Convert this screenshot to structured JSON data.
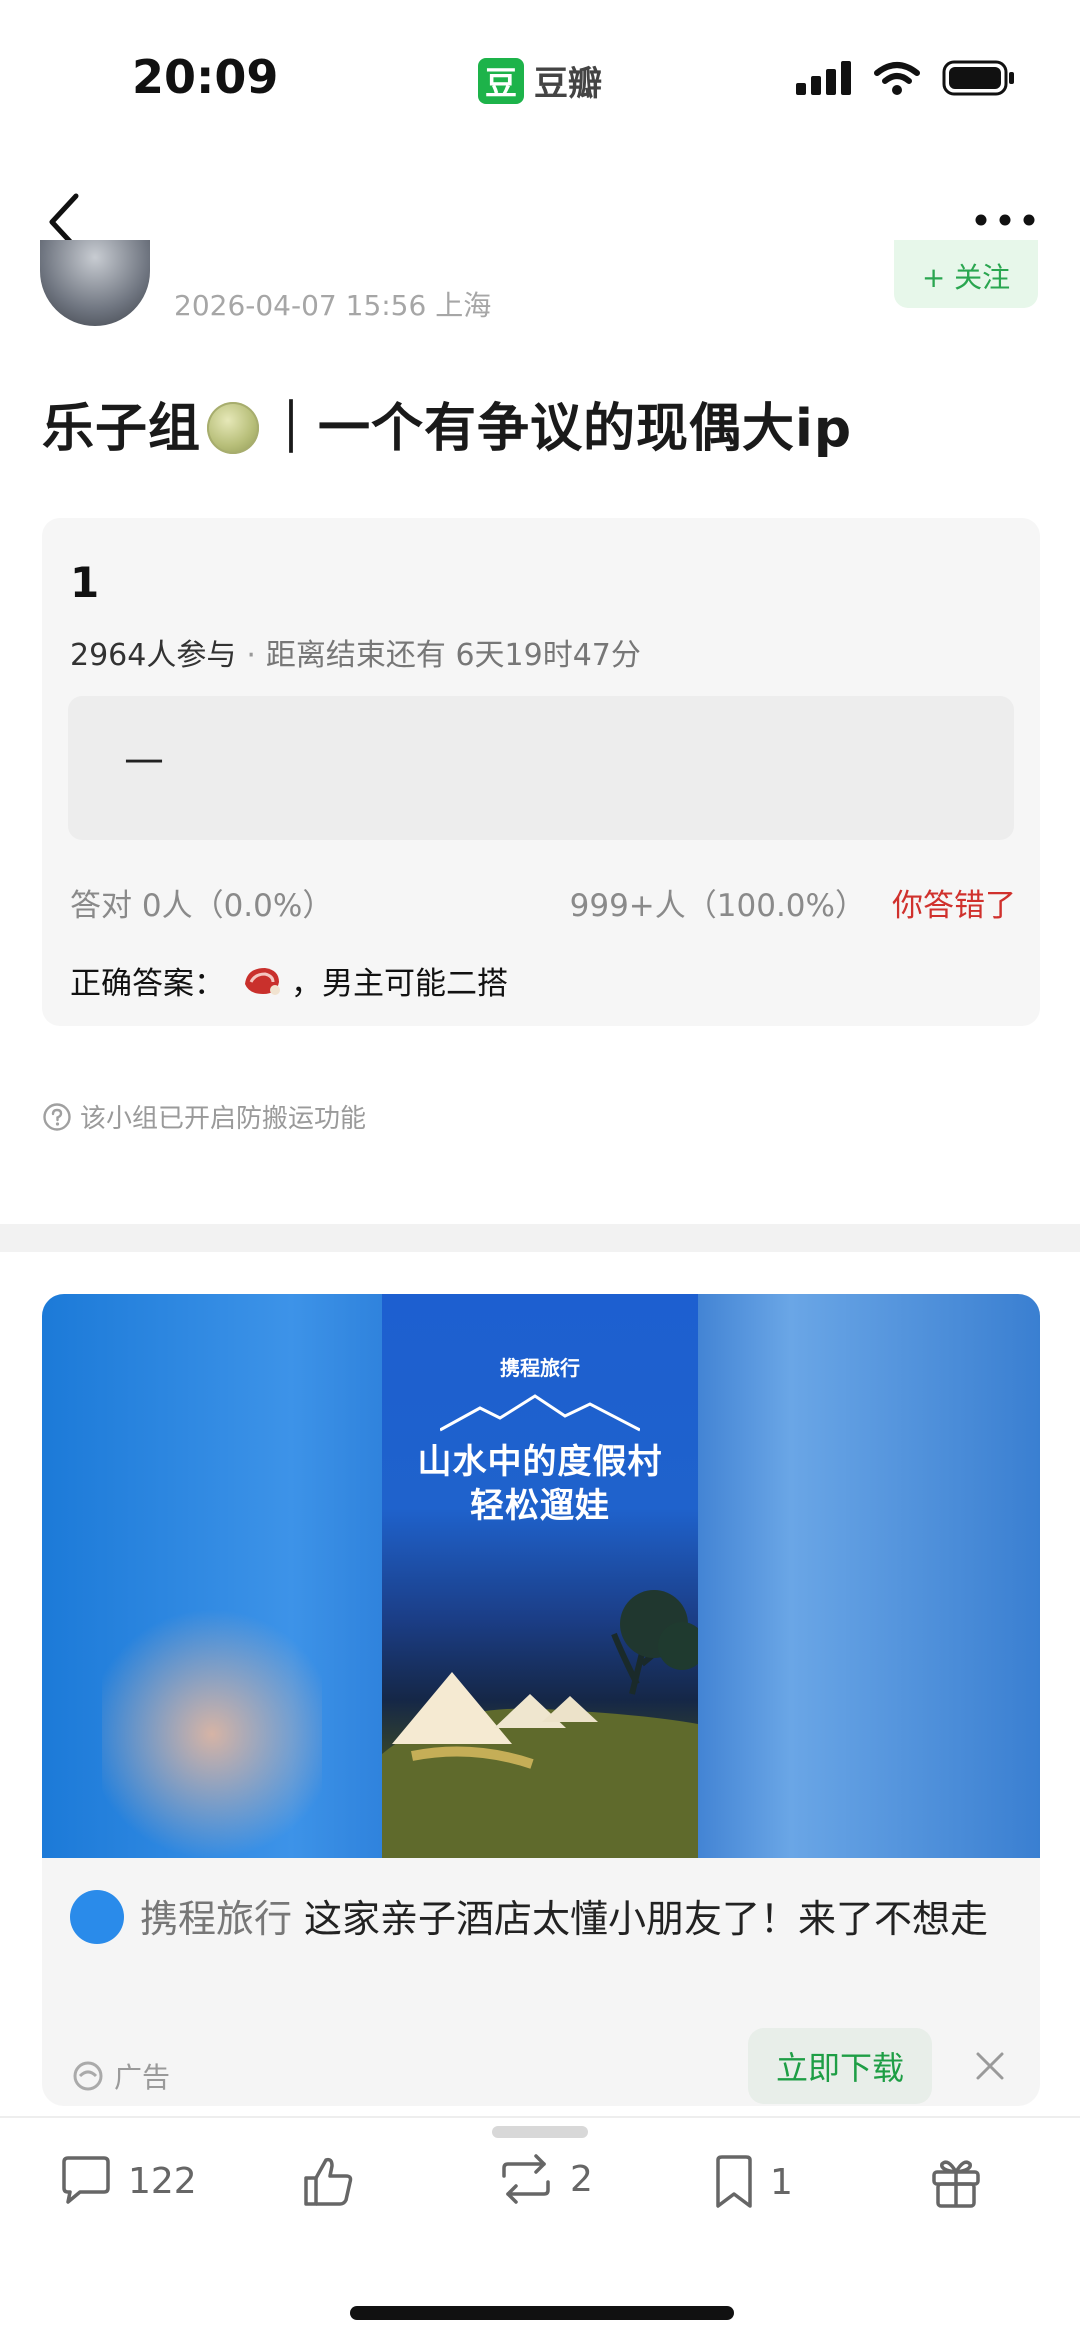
{
  "status_bar": {
    "time": "20:09",
    "app_logo": "豆",
    "app_name": "豆瓣"
  },
  "nav": {
    "back_icon": "chevron-left-icon",
    "more_icon": "more-icon"
  },
  "post": {
    "meta": "2026-04-07 15:56  上海",
    "follow_label": "+ 关注",
    "title_prefix": "乐子组",
    "title_suffix": "｜一个有争议的现偶大ip"
  },
  "poll": {
    "question": "1",
    "participants": "2964人参与",
    "countdown": "距离结束还有 6天19时47分",
    "option_text": "—",
    "correct_stat": "答对  0人（0.0%）",
    "total_stat": "999+人（100.0%）",
    "result": "你答错了",
    "answer_label": "正确答案：",
    "answer_text": "，男主可能二搭"
  },
  "anti_copy_note": "该小组已开启防搬运功能",
  "ad": {
    "poster_brand": "携程旅行",
    "poster_line1": "山水中的度假村",
    "poster_line2": "轻松遛娃",
    "brand": "携程旅行",
    "headline": "这家亲子酒店太懂小朋友了！来了不想走",
    "label": "广告",
    "cta": "立即下载"
  },
  "actions": {
    "comments": "122",
    "reshares": "2",
    "collects": "1"
  },
  "colors": {
    "accent_green": "#2aa650",
    "error_red": "#d0312d"
  }
}
